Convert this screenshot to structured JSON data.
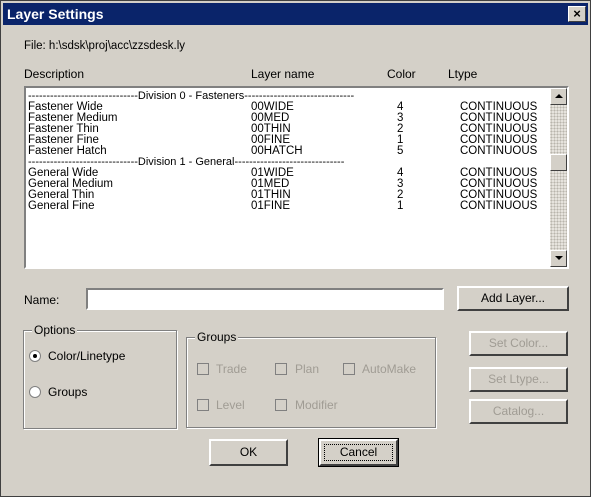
{
  "window": {
    "title": "Layer Settings",
    "close_glyph": "×"
  },
  "file_label": "File: h:\\sdsk\\proj\\acc\\zzsdesk.ly",
  "columns": {
    "description": "Description",
    "layer_name": "Layer name",
    "color": "Color",
    "ltype": "Ltype"
  },
  "division0": "------------------------------Division 0 - Fasteners------------------------------",
  "division1": "------------------------------Division 1 - General------------------------------",
  "rows": [
    {
      "description": "Fastener Wide",
      "layer": "00WIDE",
      "color": "4",
      "ltype": "CONTINUOUS"
    },
    {
      "description": "Fastener Medium",
      "layer": "00MED",
      "color": "3",
      "ltype": "CONTINUOUS"
    },
    {
      "description": "Fastener Thin",
      "layer": "00THIN",
      "color": "2",
      "ltype": "CONTINUOUS"
    },
    {
      "description": "Fastener Fine",
      "layer": "00FINE",
      "color": "1",
      "ltype": "CONTINUOUS"
    },
    {
      "description": "Fastener Hatch",
      "layer": "00HATCH",
      "color": "5",
      "ltype": "CONTINUOUS"
    },
    {
      "description": "General Wide",
      "layer": "01WIDE",
      "color": "4",
      "ltype": "CONTINUOUS"
    },
    {
      "description": "General Medium",
      "layer": "01MED",
      "color": "3",
      "ltype": "CONTINUOUS"
    },
    {
      "description": "General Thin",
      "layer": "01THIN",
      "color": "2",
      "ltype": "CONTINUOUS"
    },
    {
      "description": "General Fine",
      "layer": "01FINE",
      "color": "1",
      "ltype": "CONTINUOUS"
    }
  ],
  "name_label": "Name:",
  "name_value": "",
  "add_layer": "Add Layer...",
  "options": {
    "title": "Options",
    "color_linetype": "Color/Linetype",
    "groups": "Groups",
    "selected": "Color/Linetype"
  },
  "groups": {
    "title": "Groups",
    "trade": "Trade",
    "plan": "Plan",
    "automake": "AutoMake",
    "level": "Level",
    "modifier": "Modifier"
  },
  "set_color": "Set Color...",
  "set_ltype": "Set Ltype...",
  "catalog": "Catalog...",
  "ok": "OK",
  "cancel": "Cancel"
}
